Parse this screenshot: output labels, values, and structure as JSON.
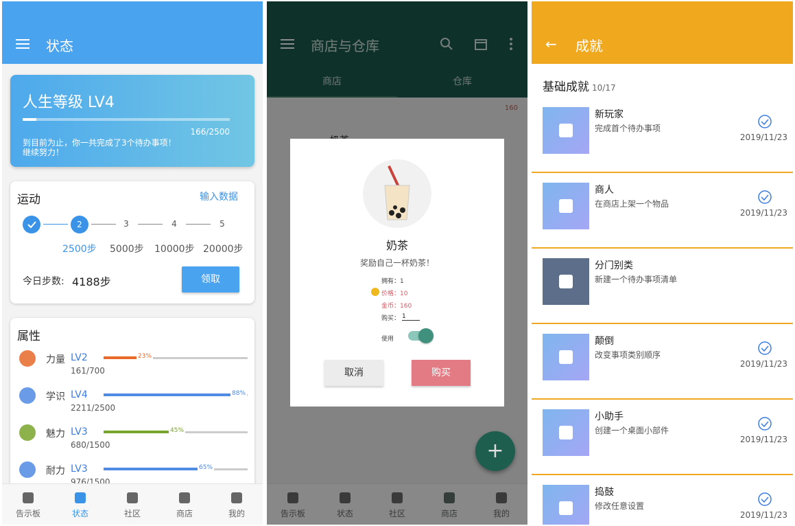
{
  "status_screen": {
    "title": "状态",
    "level": {
      "title": "人生等级 LV4",
      "progress_text": "166/2500",
      "progress_fraction": 0.066,
      "message_line1": "到目前为止，你一共完成了3个待办事项！",
      "message_line2": "继续努力！"
    },
    "sport": {
      "title": "运动",
      "input_link": "输入数据",
      "steps": [
        "2",
        "3",
        "4",
        "5"
      ],
      "step_labels": [
        "2500步",
        "5000步",
        "10000步",
        "20000步"
      ],
      "today_label": "今日步数:",
      "today_value": "4188步",
      "claim_button": "领取"
    },
    "attributes": {
      "title": "属性",
      "items": [
        {
          "name": "力量",
          "level": "LV2",
          "value": "161/700",
          "percent": "23%",
          "fraction": 0.23,
          "color": "#e8692a",
          "icon": "muscle-icon"
        },
        {
          "name": "学识",
          "level": "LV4",
          "value": "2211/2500",
          "percent": "88%",
          "fraction": 0.88,
          "color": "#4f8ae3",
          "icon": "graduation-cap-icon"
        },
        {
          "name": "魅力",
          "level": "LV3",
          "value": "680/1500",
          "percent": "45%",
          "fraction": 0.45,
          "color": "#7aa52b",
          "icon": "face-icon"
        },
        {
          "name": "耐力",
          "level": "LV3",
          "value": "976/1500",
          "percent": "65%",
          "fraction": 0.65,
          "color": "#4f8ae3",
          "icon": "clock-icon"
        }
      ]
    },
    "nav": {
      "items": [
        "告示板",
        "状态",
        "社区",
        "商店",
        "我的"
      ],
      "active_index": 1,
      "active_color": "#3a93e6"
    }
  },
  "shop_screen": {
    "title": "商店与仓库",
    "tabs": [
      "商店",
      "仓库"
    ],
    "coins": "160",
    "item_name": "奶茶",
    "dialog": {
      "title": "奶茶",
      "subtitle": "奖励自己一杯奶茶！",
      "owned": "拥有：1",
      "price": "价格：10",
      "gold": "金币：160",
      "buy_label": "购买：",
      "buy_value": "1",
      "use_label": "使用",
      "use_enabled": true,
      "cancel_button": "取消",
      "buy_button": "购买"
    },
    "fab_label": "+",
    "nav": {
      "items": [
        "告示板",
        "状态",
        "社区",
        "商店",
        "我的"
      ],
      "active_index": 3
    }
  },
  "achievements_screen": {
    "title": "成就",
    "section": "基础成就",
    "count": "10/17",
    "items": [
      {
        "name": "新玩家",
        "desc": "完成首个待办事项",
        "date": "2019/11/23",
        "unlocked": true,
        "icon": "graduation-cap-icon"
      },
      {
        "name": "商人",
        "desc": "在商店上架一个物品",
        "date": "2019/11/23",
        "unlocked": true,
        "icon": "store-icon"
      },
      {
        "name": "分门别类",
        "desc": "新建一个待办事项清单",
        "date": "",
        "unlocked": false,
        "icon": "lock-icon"
      },
      {
        "name": "颠倒",
        "desc": "改变事项类别顺序",
        "date": "2019/11/23",
        "unlocked": true,
        "icon": "reorder-icon"
      },
      {
        "name": "小助手",
        "desc": "创建一个桌面小部件",
        "date": "2019/11/23",
        "unlocked": true,
        "icon": "cube-icon"
      },
      {
        "name": "捣鼓",
        "desc": "修改任意设置",
        "date": "2019/11/23",
        "unlocked": true,
        "icon": "gear-icon"
      }
    ]
  }
}
